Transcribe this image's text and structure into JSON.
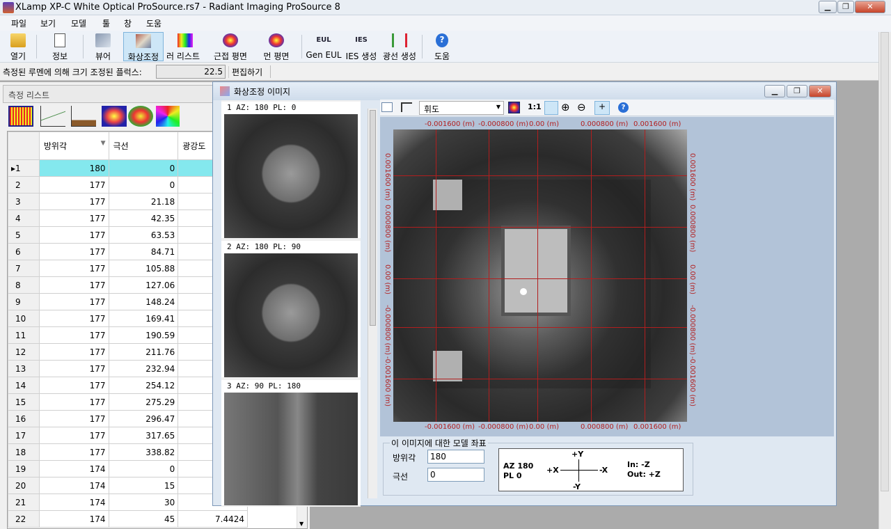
{
  "window": {
    "title": "XLamp XP-C White Optical ProSource.rs7 - Radiant Imaging ProSource 8"
  },
  "menu": [
    "파일",
    "보기",
    "모델",
    "툴",
    "창",
    "도움"
  ],
  "toolbar": [
    {
      "label": "열기",
      "icon": "folder-open-icon"
    },
    {
      "label": "정보",
      "icon": "notepad-icon"
    },
    {
      "label": "뷰어",
      "icon": "viewer-icon"
    },
    {
      "label": "화상조정",
      "icon": "image-adjust-icon"
    },
    {
      "label": "컬러 리스트",
      "icon": "color-list-icon"
    },
    {
      "label": "근접 평면",
      "icon": "near-field-icon"
    },
    {
      "label": "먼 평면",
      "icon": "far-field-icon"
    },
    {
      "label": "Gen EUL",
      "icon": "eul-icon"
    },
    {
      "label": "IES 생성",
      "icon": "ies-icon"
    },
    {
      "label": "광선 생성",
      "icon": "ray-icon"
    },
    {
      "label": "도움",
      "icon": "help-icon"
    }
  ],
  "sizebar": {
    "label": "측정된 루멘에 의해 크기 조정된 플럭스:",
    "value": "22.5",
    "edit": "편집하기"
  },
  "measure_list": {
    "title": "측정 리스트",
    "columns": [
      "방위각",
      "극선",
      "광강도"
    ],
    "rows": [
      {
        "n": "1",
        "az": "180",
        "pl": "0",
        "iv": ""
      },
      {
        "n": "2",
        "az": "177",
        "pl": "0",
        "iv": ""
      },
      {
        "n": "3",
        "az": "177",
        "pl": "21.18",
        "iv": ""
      },
      {
        "n": "4",
        "az": "177",
        "pl": "42.35",
        "iv": ""
      },
      {
        "n": "5",
        "az": "177",
        "pl": "63.53",
        "iv": ""
      },
      {
        "n": "6",
        "az": "177",
        "pl": "84.71",
        "iv": ""
      },
      {
        "n": "7",
        "az": "177",
        "pl": "105.88",
        "iv": ""
      },
      {
        "n": "8",
        "az": "177",
        "pl": "127.06",
        "iv": ""
      },
      {
        "n": "9",
        "az": "177",
        "pl": "148.24",
        "iv": ""
      },
      {
        "n": "10",
        "az": "177",
        "pl": "169.41",
        "iv": ""
      },
      {
        "n": "11",
        "az": "177",
        "pl": "190.59",
        "iv": ""
      },
      {
        "n": "12",
        "az": "177",
        "pl": "211.76",
        "iv": ""
      },
      {
        "n": "13",
        "az": "177",
        "pl": "232.94",
        "iv": ""
      },
      {
        "n": "14",
        "az": "177",
        "pl": "254.12",
        "iv": ""
      },
      {
        "n": "15",
        "az": "177",
        "pl": "275.29",
        "iv": ""
      },
      {
        "n": "16",
        "az": "177",
        "pl": "296.47",
        "iv": ""
      },
      {
        "n": "17",
        "az": "177",
        "pl": "317.65",
        "iv": ""
      },
      {
        "n": "18",
        "az": "177",
        "pl": "338.82",
        "iv": ""
      },
      {
        "n": "19",
        "az": "174",
        "pl": "0",
        "iv": ""
      },
      {
        "n": "20",
        "az": "174",
        "pl": "15",
        "iv": ""
      },
      {
        "n": "21",
        "az": "174",
        "pl": "30",
        "iv": ""
      },
      {
        "n": "22",
        "az": "174",
        "pl": "45",
        "iv": "7.4424"
      }
    ]
  },
  "image_window": {
    "title": "화상조정 이미지",
    "thumbs": [
      "1 AZ: 180  PL: 0",
      "2 AZ: 180  PL: 90",
      "3 AZ: 90  PL: 180"
    ],
    "mode": "휘도",
    "zoom": "1:1",
    "axis_top": [
      "-0.001600 (m)",
      "-0.000800 (m)",
      "0.00 (m)",
      "0.000800 (m)",
      "0.001600 (m)"
    ],
    "axis_side": [
      "0.001600 (m)",
      "0.000800 (m)",
      "0.00 (m)",
      "-0.000800 (m)",
      "-0.001600 (m)"
    ],
    "coords_title": "이 이미지에 대한 모델 좌표",
    "az_label": "방위각",
    "az_value": "180",
    "pl_label": "극선",
    "pl_value": "0",
    "diag": {
      "az": "AZ 180",
      "pl": "PL    0",
      "py": "+Y",
      "ny": "-Y",
      "px": "+X",
      "nx": "-X",
      "in": "In:   -Z",
      "out": "Out: +Z"
    }
  }
}
